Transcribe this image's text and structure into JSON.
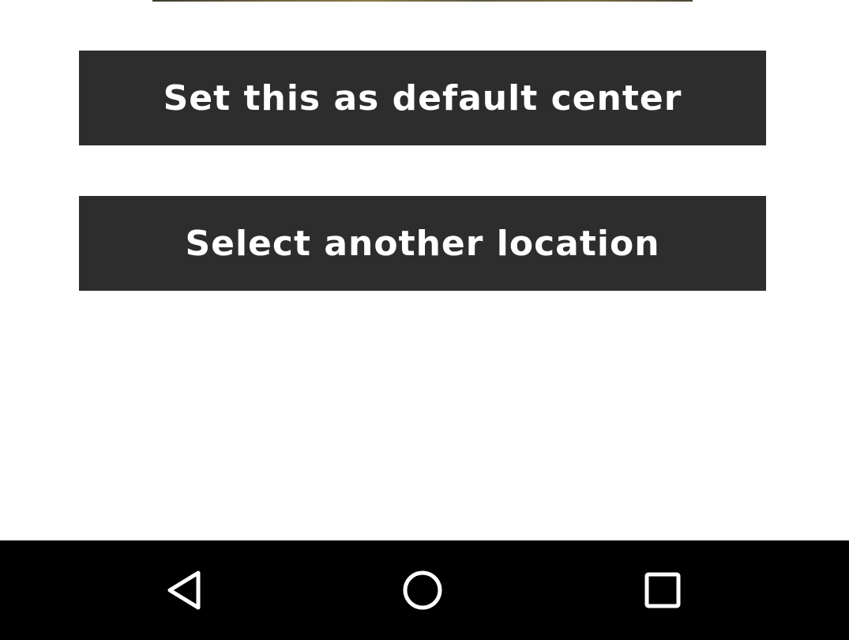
{
  "actions": {
    "set_default_label": "Set this as default center",
    "select_location_label": "Select another location"
  },
  "colors": {
    "button_bg": "#2d2d2d",
    "button_text": "#ffffff",
    "nav_bar_bg": "#000000",
    "nav_icon": "#ffffff",
    "page_bg": "#ffffff"
  },
  "nav_bar": {
    "icons": [
      "back-icon",
      "home-icon",
      "recents-icon"
    ]
  }
}
